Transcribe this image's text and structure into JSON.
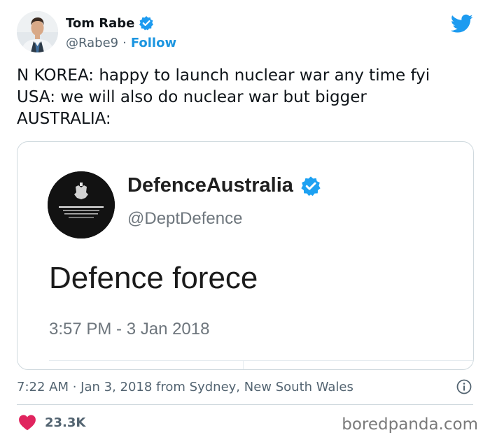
{
  "author": {
    "display_name": "Tom Rabe",
    "handle": "@Rabe9",
    "separator": "·",
    "follow_label": "Follow"
  },
  "tweet": {
    "text": "N KOREA: happy to launch nuclear war any time fyi\nUSA: we will also do nuclear war but bigger\nAUSTRALIA:"
  },
  "embedded_tweet": {
    "display_name": "DefenceAustralia",
    "handle": "@DeptDefence",
    "text": "Defence forece",
    "timestamp": "3:57 PM - 3 Jan 2018"
  },
  "meta": {
    "timestamp_location": "7:22 AM · Jan 3, 2018 from Sydney, New South Wales"
  },
  "actions": {
    "likes": "23.3K"
  },
  "watermark": "boredpanda.com",
  "icons": {
    "verified": "verified-badge-icon",
    "twitter": "twitter-bird-icon",
    "info": "info-icon",
    "like": "heart-icon"
  },
  "colors": {
    "twitter_blue": "#1d9bf0",
    "heart_red": "#e0245e",
    "secondary_text": "#536471"
  }
}
